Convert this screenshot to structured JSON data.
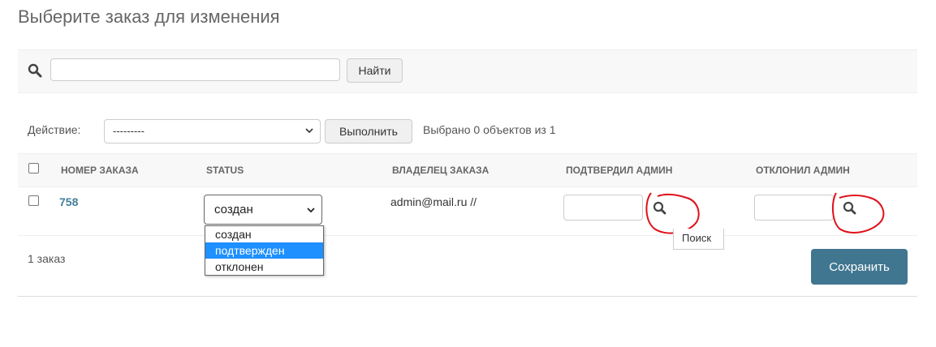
{
  "page": {
    "title": "Выберите заказ для изменения"
  },
  "search": {
    "value": "",
    "placeholder": "",
    "button_label": "Найти",
    "icon": "search-icon"
  },
  "actions": {
    "label": "Действие:",
    "selected": "---------",
    "run_label": "Выполнить",
    "selection_count": "Выбрано 0 объектов из 1"
  },
  "table": {
    "headers": [
      "НОМЕР ЗАКАЗА",
      "STATUS",
      "ВЛАДЕЛЕЦ ЗАКАЗА",
      "ПОДТВЕРДИЛ АДМИН",
      "ОТКЛОНИЛ АДМИН"
    ],
    "rows": [
      {
        "order_number": "758",
        "status_value": "создан",
        "status_options": [
          "создан",
          "подтвержден",
          "отклонен"
        ],
        "highlighted_option": "подтвержден",
        "owner": "admin@mail.ru //",
        "confirmed_admin": "",
        "rejected_admin": ""
      }
    ]
  },
  "tooltip": {
    "text": "Поиск"
  },
  "footer": {
    "count": "1 заказ",
    "save_label": "Сохранить"
  },
  "colors": {
    "link": "#447e9b",
    "primary_button": "#417690",
    "highlight": "#1e90ff",
    "annotation": "#e0101a"
  }
}
